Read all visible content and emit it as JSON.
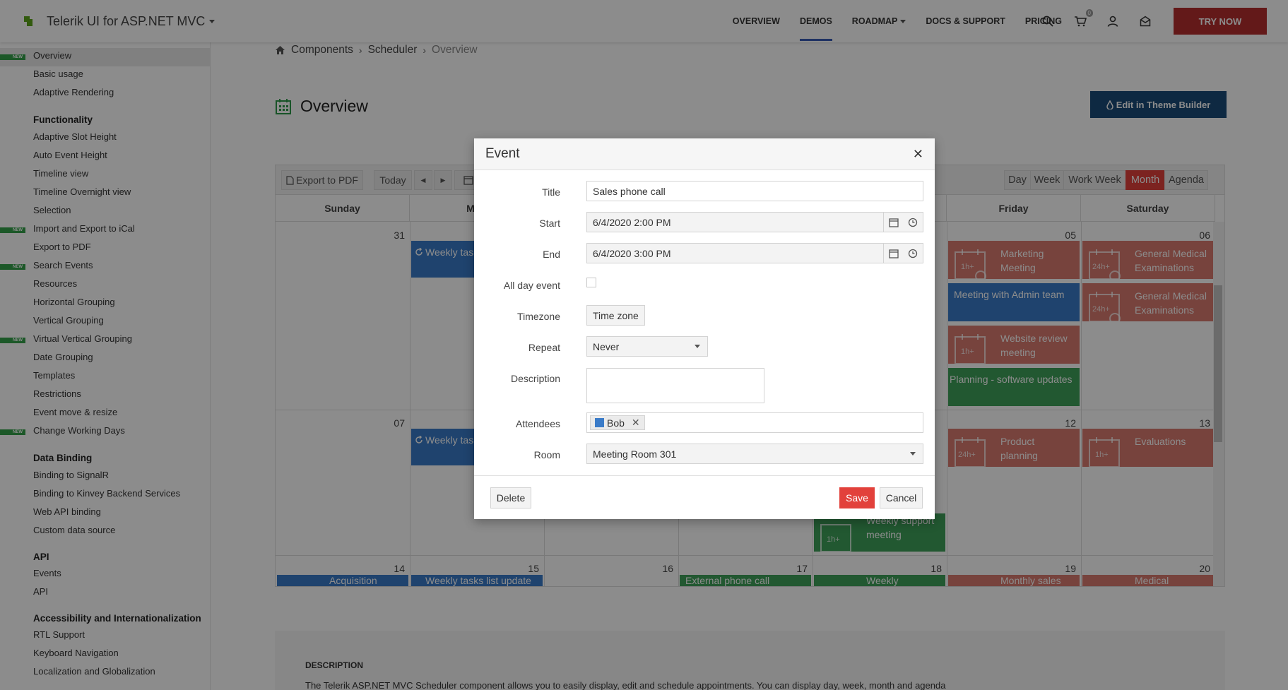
{
  "header": {
    "brand": "Telerik UI for ASP.NET MVC",
    "nav": [
      {
        "label": "OVERVIEW"
      },
      {
        "label": "DEMOS"
      },
      {
        "label": "ROADMAP"
      },
      {
        "label": "DOCS & SUPPORT"
      },
      {
        "label": "PRICING"
      }
    ],
    "cart_count": "0",
    "try_now": "TRY NOW"
  },
  "sidebar": {
    "items": [
      {
        "label": "Overview"
      },
      {
        "label": "Basic usage"
      },
      {
        "label": "Adaptive Rendering"
      },
      {
        "label": "Functionality"
      },
      {
        "label": "Adaptive Slot Height"
      },
      {
        "label": "Auto Event Height"
      },
      {
        "label": "Timeline view"
      },
      {
        "label": "Timeline Overnight view"
      },
      {
        "label": "Selection"
      },
      {
        "label": "Import and Export to iCal"
      },
      {
        "label": "Export to PDF"
      },
      {
        "label": "Search Events"
      },
      {
        "label": "Resources"
      },
      {
        "label": "Horizontal Grouping"
      },
      {
        "label": "Vertical Grouping"
      },
      {
        "label": "Virtual Vertical Grouping"
      },
      {
        "label": "Date Grouping"
      },
      {
        "label": "Templates"
      },
      {
        "label": "Restrictions"
      },
      {
        "label": "Event move & resize"
      },
      {
        "label": "Change Working Days"
      },
      {
        "label": "Data Binding"
      },
      {
        "label": "Binding to SignalR"
      },
      {
        "label": "Binding to Kinvey Backend Services"
      },
      {
        "label": "Web API binding"
      },
      {
        "label": "Custom data source"
      },
      {
        "label": "API"
      },
      {
        "label": "Events"
      },
      {
        "label": "API"
      },
      {
        "label": "Accessibility and Internationalization"
      },
      {
        "label": "RTL Support"
      },
      {
        "label": "Keyboard Navigation"
      },
      {
        "label": "Localization and Globalization"
      }
    ],
    "new_tag": "NEW"
  },
  "breadcrumb": [
    "Components",
    "Scheduler",
    "Overview"
  ],
  "page_title": "Overview",
  "theme_builder_button": "Edit in Theme Builder",
  "scheduler": {
    "toolbar": {
      "export_pdf": "Export to PDF",
      "today": "Today",
      "views": [
        "Day",
        "Week",
        "Work Week",
        "Month",
        "Agenda"
      ],
      "active_view": "Month"
    },
    "days": [
      "Sunday",
      "Mon",
      "Friday",
      "Saturday"
    ],
    "dates": {
      "row1": [
        "31",
        "05",
        "06"
      ],
      "row2": [
        "07",
        "12",
        "13"
      ],
      "row3": [
        "14",
        "15",
        "16",
        "17",
        "18",
        "19",
        "20"
      ]
    },
    "events": {
      "weekly_tasks": "Weekly tas",
      "marketing_meeting": "Marketing Meeting",
      "general_medical_1": "General Medical Examinations",
      "meeting_admin": "Meeting with Admin team",
      "general_medical_2": "General Medical Examinations",
      "website_review": "Website review meeting",
      "planning_software": "Planning - software updates",
      "weekly_tasks_2": "Weekly tas",
      "product_planning": "Product planning",
      "evaluations": "Evaluations",
      "weekly_support": "Weekly support meeting",
      "acquisition": "Acquisition",
      "weekly_tasks_list": "Weekly tasks list update",
      "external_phone": "External phone call",
      "weekly": "Weekly",
      "monthly_sales": "Monthly sales",
      "medical": "Medical",
      "badge_1h": "1h+",
      "badge_24h": "24h+"
    }
  },
  "dialog": {
    "title": "Event",
    "labels": {
      "title": "Title",
      "start": "Start",
      "end": "End",
      "all_day": "All day event",
      "timezone": "Timezone",
      "repeat": "Repeat",
      "description": "Description",
      "attendees": "Attendees",
      "room": "Room"
    },
    "values": {
      "title": "Sales phone call",
      "start": "6/4/2020 2:00 PM",
      "end": "6/4/2020 3:00 PM",
      "timezone_button": "Time zone",
      "repeat": "Never",
      "description": "",
      "attendee": "Bob",
      "room": "Meeting Room 301"
    },
    "buttons": {
      "delete": "Delete",
      "save": "Save",
      "cancel": "Cancel"
    }
  },
  "description": {
    "heading": "DESCRIPTION",
    "text": "The Telerik ASP.NET MVC Scheduler component allows you to easily display, edit and schedule appointments. You can display day, week, month and agenda"
  },
  "colors": {
    "accent_red": "#e2413b",
    "event_blue": "#3a7bc8",
    "event_red": "#d97a6f",
    "event_green": "#3ea05a",
    "theme_button": "#1a4c79"
  }
}
